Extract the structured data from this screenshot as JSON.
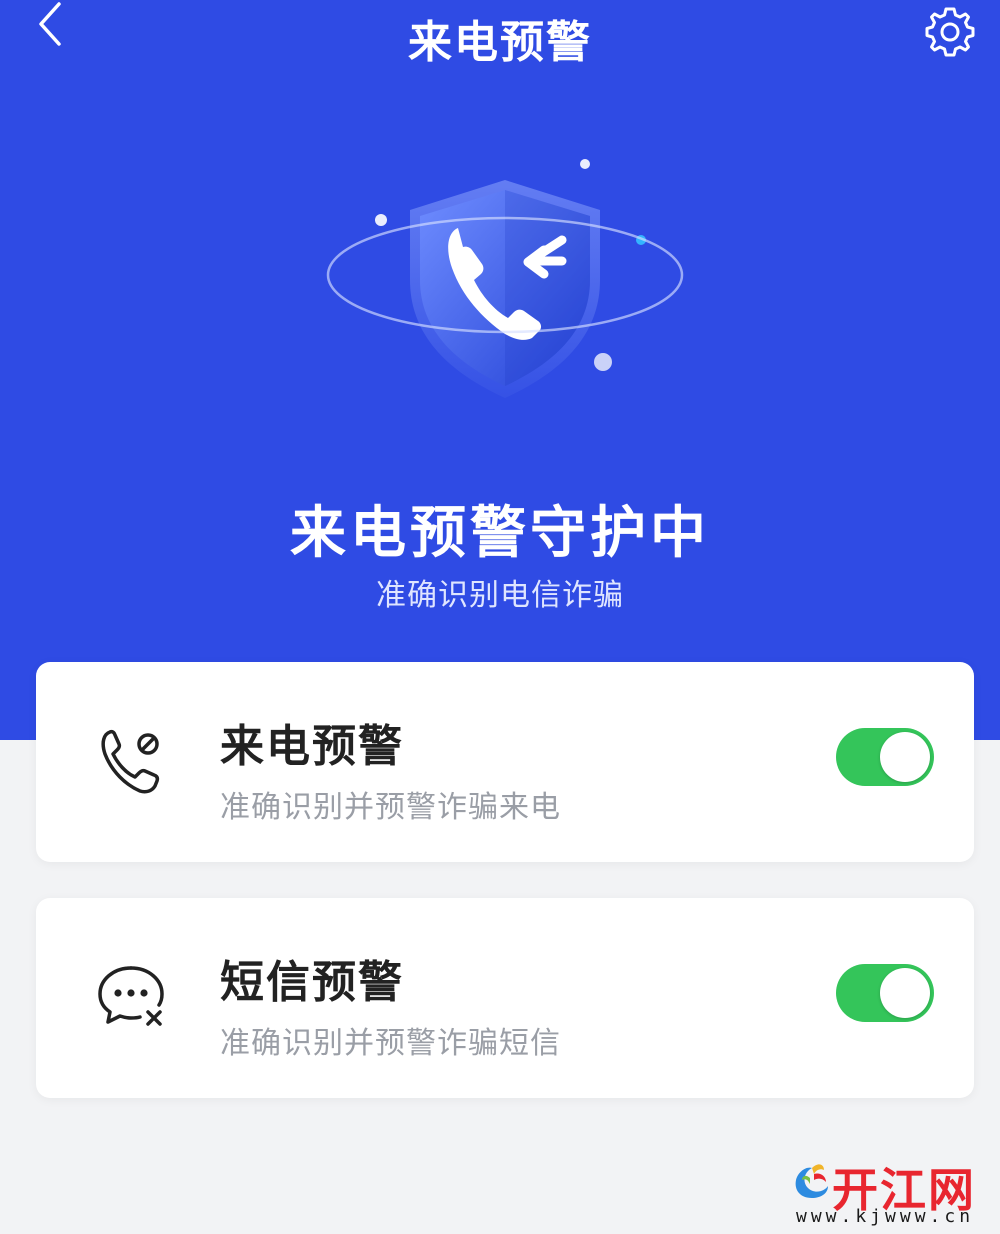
{
  "header": {
    "title": "来电预警",
    "back_icon": "chevron-left-icon",
    "settings_icon": "gear-icon"
  },
  "hero": {
    "title": "来电预警守护中",
    "subtitle": "准确识别电信诈骗",
    "illustration_icon": "shield-incoming-call-icon"
  },
  "settings": [
    {
      "title": "来电预警",
      "description": "准确识别并预警诈骗来电",
      "icon": "phone-block-icon",
      "enabled": true
    },
    {
      "title": "短信预警",
      "description": "准确识别并预警诈骗短信",
      "icon": "message-block-icon",
      "enabled": true
    }
  ],
  "watermark": {
    "text": "开江网",
    "url": "www.kjwww.cn"
  },
  "colors": {
    "hero_bg": "#2f4be4",
    "page_bg": "#f2f3f5",
    "toggle_on": "#34c55a",
    "watermark_red": "#e8262f"
  }
}
